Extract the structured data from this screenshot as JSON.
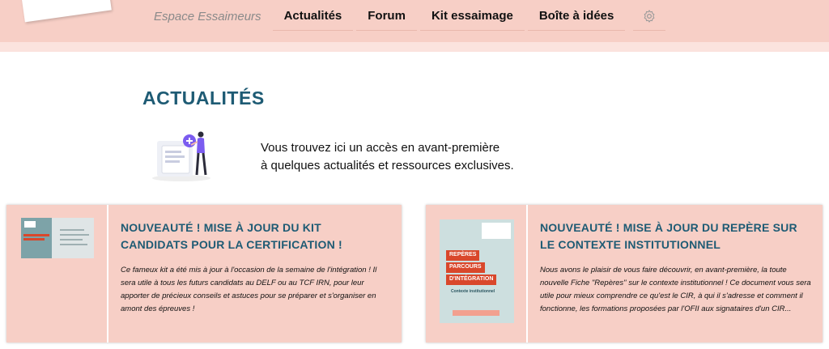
{
  "nav": {
    "brand": "Espace Essaimeurs",
    "items": [
      "Actualités",
      "Forum",
      "Kit essaimage",
      "Boîte à idées"
    ],
    "settings_icon": "gear-icon"
  },
  "page": {
    "title": "ACTUALITÉS",
    "intro_line1": "Vous trouvez ici un accès en avant-première",
    "intro_line2": "à quelques actualités et ressources exclusives."
  },
  "cards": [
    {
      "title": "NOUVEAUTÉ ! MISE À JOUR DU KIT CANDIDATS POUR LA CERTIFICATION !",
      "description": "Ce fameux kit a été mis à jour à l'occasion de la semaine de l'intégration ! Il sera utile à tous les futurs candidats au DELF ou au TCF IRN, pour leur apporter de précieux conseils et astuces pour se préparer et s'organiser en amont des épreuves !"
    },
    {
      "title": "NOUVEAUTÉ ! MISE À JOUR DU REPÈRE SUR LE CONTEXTE INSTITUTIONNEL",
      "description": "Nous avons le plaisir de vous faire découvrir, en avant-première, la toute nouvelle Fiche \"Repères\" sur le contexte institutionnel ! Ce document vous sera utile pour mieux comprendre ce qu'est le CIR, à qui il s'adresse et comment il fonctionne, les formations proposées par l'OFII aux signataires d'un CIR...",
      "thumb_tags": [
        "REPÈRES",
        "PARCOURS",
        "D'INTÉGRATION"
      ],
      "thumb_subtitle": "Contexte institutionnel"
    }
  ],
  "colors": {
    "topbar": "#f7cfc6",
    "accent_teal": "#1e5b74",
    "accent_red": "#d9472b",
    "illustration_purple": "#7b5cf0"
  }
}
